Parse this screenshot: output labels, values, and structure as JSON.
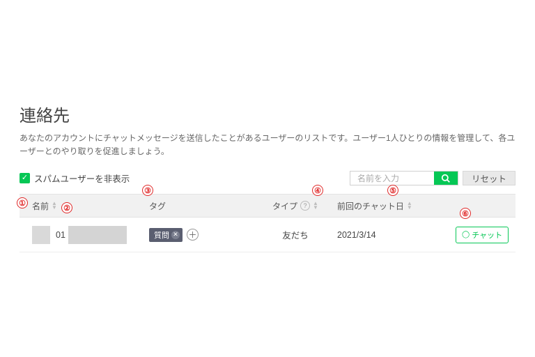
{
  "header": {
    "title": "連絡先",
    "description": "あなたのアカウントにチャットメッセージを送信したことがあるユーザーのリストです。ユーザー1人ひとりの情報を管理して、各ユーザーとのやり取りを促進しましょう。"
  },
  "controls": {
    "hide_spam_label": "スパムユーザーを非表示",
    "hide_spam_checked": true,
    "search_placeholder": "名前を入力",
    "reset_label": "リセット"
  },
  "columns": {
    "name": "名前",
    "tag": "タグ",
    "type": "タイプ",
    "date": "前回のチャット日"
  },
  "rows": [
    {
      "name_text": "01",
      "tags": [
        "質問"
      ],
      "type": "友だち",
      "last_chat": "2021/3/14",
      "action_label": "チャット"
    }
  ],
  "callouts": {
    "1": "①",
    "2": "②",
    "3": "③",
    "4": "④",
    "5": "⑤",
    "6": "⑥"
  }
}
